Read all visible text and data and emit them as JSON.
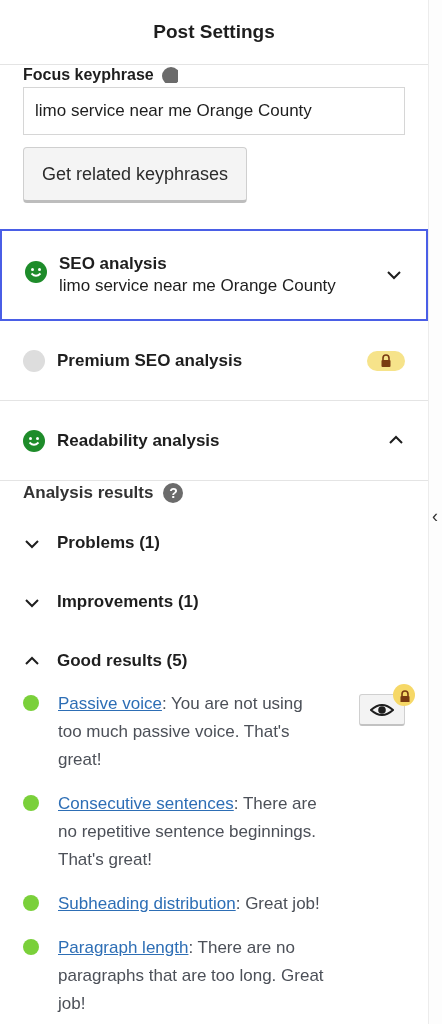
{
  "header": {
    "title": "Post Settings"
  },
  "focus_keyphrase": {
    "label": "Focus keyphrase",
    "value": "limo service near me Orange County",
    "button": "Get related keyphrases"
  },
  "sections": [
    {
      "kind": "collapsible",
      "title": "SEO analysis",
      "subtitle": "limo service near me Orange County",
      "color": "#1e8c2a",
      "expanded": false,
      "focused": true
    },
    {
      "kind": "premium",
      "title": "Premium SEO analysis",
      "color": "#dddddd",
      "focused": false
    },
    {
      "kind": "collapsible",
      "title": "Readability analysis",
      "color": "#1e8c2a",
      "expanded": true,
      "focused": false
    }
  ],
  "analysis": {
    "title": "Analysis results",
    "help_glyph": "?",
    "groups": [
      {
        "title": "Problems (1)",
        "expanded": false
      },
      {
        "title": "Improvements (1)",
        "expanded": false
      },
      {
        "title": "Good results (5)",
        "expanded": true,
        "results": [
          {
            "link": "Passive voice",
            "text": ": You are not using too much passive voice. That's great!",
            "color": "#7ad03a",
            "highlight_button": true
          },
          {
            "link": "Consecutive sentences",
            "text": ": There are no repetitive sentence beginnings. That's great!",
            "color": "#7ad03a",
            "highlight_button": false
          },
          {
            "link": "Subheading distribution",
            "text": ": Great job!",
            "color": "#7ad03a",
            "highlight_button": false
          },
          {
            "link": "Paragraph length",
            "text": ": There are no paragraphs that are too long. Great job!",
            "color": "#7ad03a",
            "highlight_button": false
          }
        ]
      }
    ]
  },
  "sidebar_toggle": {
    "glyph": "‹"
  }
}
